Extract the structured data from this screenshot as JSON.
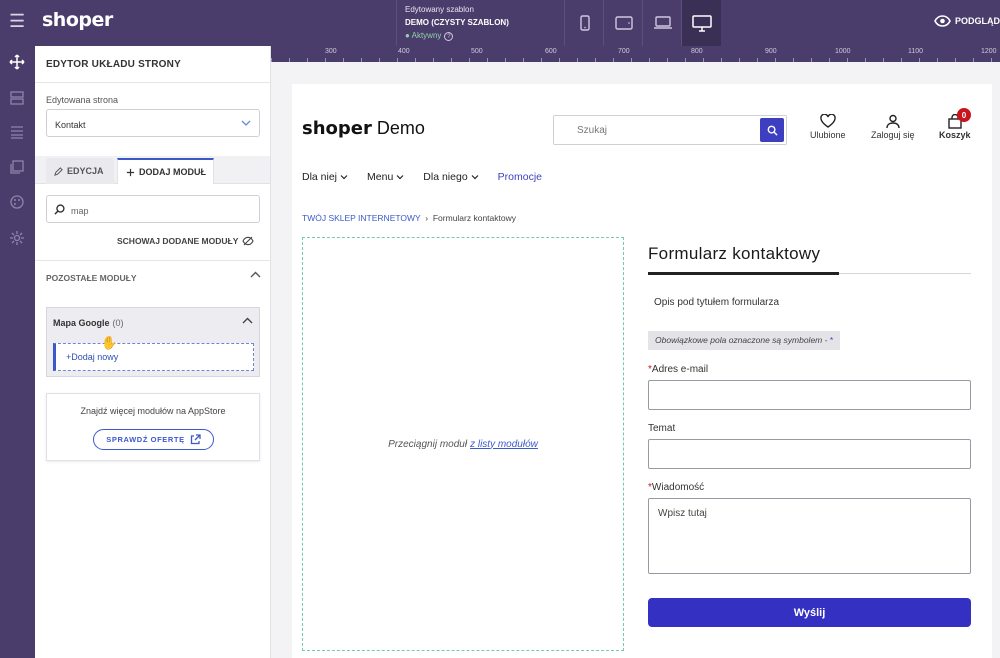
{
  "topbar": {
    "logo": "shoper",
    "template_caption": "Edytowany szablon",
    "template_name": "DEMO (CZYSTY SZABLON)",
    "template_status": "Aktywny",
    "preview_label": "PODGLĄD",
    "colors": {
      "bg": "#4b3d6b",
      "status": "#8fd3a8"
    }
  },
  "rail": {
    "icons": [
      "move-icon",
      "layout-icon",
      "list-icon",
      "pages-icon",
      "palette-icon",
      "settings-icon"
    ]
  },
  "panel": {
    "title": "EDYTOR UKŁADU STRONY",
    "page_label": "Edytowana strona",
    "page_value": "Kontakt",
    "tabs": [
      {
        "label": "EDYCJA",
        "icon": "pencil-icon"
      },
      {
        "label": "DODAJ MODUŁ",
        "icon": "plus-icon"
      }
    ],
    "search_value": "map",
    "hide_added_label": "SCHOWAJ DODANE MODUŁY",
    "section_title": "POZOSTAŁE MODUŁY",
    "module": {
      "name": "Mapa Google",
      "count": "(0)",
      "add_label": "+Dodaj nowy"
    },
    "appstore": {
      "text": "Znajdź więcej modułów na AppStore",
      "button": "SPRAWDŹ OFERTĘ"
    }
  },
  "ruler": {
    "ticks": [
      "300",
      "400",
      "500",
      "600",
      "700",
      "800",
      "900",
      "1000",
      "1100",
      "1200"
    ]
  },
  "shop": {
    "logo_bold": "shoper",
    "logo_rest": " Demo",
    "search_placeholder": "Szukaj",
    "favorites": "Ulubione",
    "login": "Zaloguj się",
    "cart": "Koszyk",
    "cart_count": "0",
    "nav": [
      "Dla niej",
      "Menu",
      "Dla niego",
      "Promocje"
    ],
    "breadcrumb_home": "TWÓJ SKLEP INTERNETOWY",
    "breadcrumb_current": "Formularz kontaktowy",
    "drop_text": "Przeciągnij moduł",
    "drop_link": "z listy modułów",
    "form": {
      "title": "Formularz kontaktowy",
      "description": "Opis pod tytułem formularza",
      "required_note": "Obowiązkowe pola oznaczone są symbolem -",
      "required_symbol": "*",
      "email_label": "Adres e-mail",
      "subject_label": "Temat",
      "message_label": "Wiadomość",
      "message_placeholder": "Wpisz tutaj",
      "submit": "Wyślij"
    },
    "colors": {
      "accent": "#3430c1",
      "badge": "#c8141c",
      "link": "#3d59c9"
    }
  }
}
